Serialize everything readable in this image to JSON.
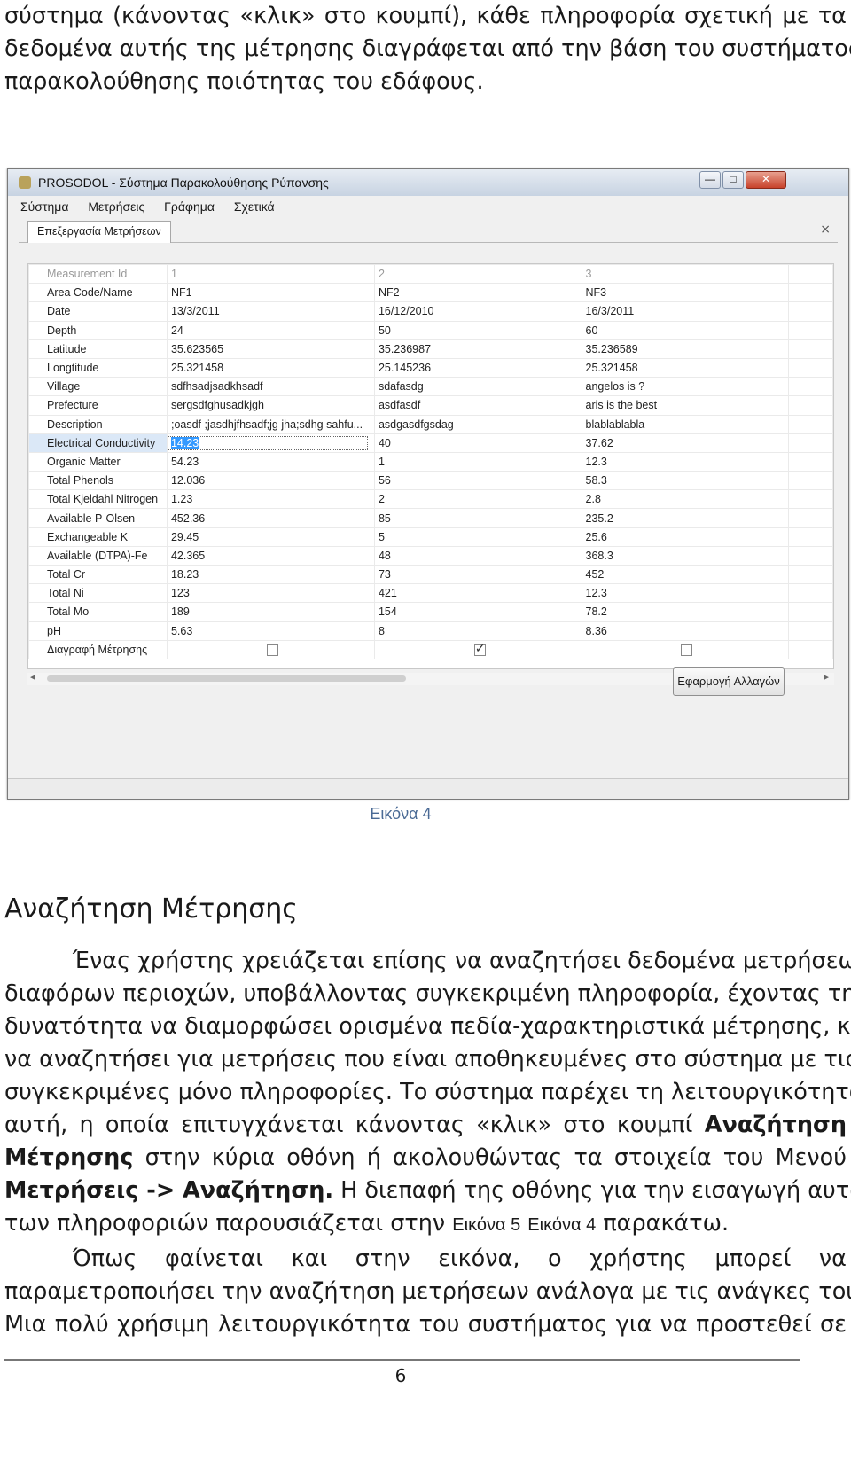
{
  "top_paragraph": [
    "σύστημα (κάνοντας «κλικ» στο κουμπί), κάθε πληροφορία σχετική με τα",
    "δεδομένα αυτής της μέτρησης διαγράφεται από την βάση του συστήματος",
    "παρακολούθησης ποιότητας του εδάφους."
  ],
  "window": {
    "title": "PROSODOL - Σύστημα Παρακολούθησης Ρύπανσης",
    "controls": {
      "minimize": "—",
      "maximize": "□",
      "close": "✕"
    },
    "menu": [
      "Σύστημα",
      "Μετρήσεις",
      "Γράφημα",
      "Σχετικά"
    ],
    "tab": "Επεξεργασία Μετρήσεων",
    "tab_close": "×",
    "grid": {
      "header": {
        "label": "Measurement Id",
        "values": [
          "1",
          "2",
          "3"
        ]
      },
      "rows": [
        {
          "label": "Area Code/Name",
          "values": [
            "NF1",
            "NF2",
            "NF3"
          ]
        },
        {
          "label": "Date",
          "values": [
            "13/3/2011",
            "16/12/2010",
            "16/3/2011"
          ]
        },
        {
          "label": "Depth",
          "values": [
            "24",
            "50",
            "60"
          ]
        },
        {
          "label": "Latitude",
          "values": [
            "35.623565",
            "35.236987",
            "35.236589"
          ]
        },
        {
          "label": "Longtitude",
          "values": [
            "25.321458",
            "25.145236",
            "25.321458"
          ]
        },
        {
          "label": "Village",
          "values": [
            "sdfhsadjsadkhsadf",
            "sdafasdg",
            "angelos is ?"
          ]
        },
        {
          "label": "Prefecture",
          "values": [
            "sergsdfghusadkjgh",
            "asdfasdf",
            "aris is the best"
          ]
        },
        {
          "label": "Description",
          "values": [
            ";oasdf ;jasdhjfhsadf;jg jha;sdhg sahfu...",
            "asdgasdfgsdag",
            "blablablabla"
          ]
        },
        {
          "label": "Electrical Conductivity",
          "values": [
            "14.23",
            "40",
            "37.62"
          ]
        },
        {
          "label": "Organic Matter",
          "values": [
            "54.23",
            "1",
            "12.3"
          ]
        },
        {
          "label": "Total Phenols",
          "values": [
            "12.036",
            "56",
            "58.3"
          ]
        },
        {
          "label": "Total Kjeldahl Nitrogen",
          "values": [
            "1.23",
            "2",
            "2.8"
          ]
        },
        {
          "label": "Available P-Olsen",
          "values": [
            "452.36",
            "85",
            "235.2"
          ]
        },
        {
          "label": "Exchangeable K",
          "values": [
            "29.45",
            "5",
            "25.6"
          ]
        },
        {
          "label": "Available (DTPA)-Fe",
          "values": [
            "42.365",
            "48",
            "368.3"
          ]
        },
        {
          "label": "Total Cr",
          "values": [
            "18.23",
            "73",
            "452"
          ]
        },
        {
          "label": "Total Ni",
          "values": [
            "123",
            "421",
            "12.3"
          ]
        },
        {
          "label": "Total Mo",
          "values": [
            "189",
            "154",
            "78.2"
          ]
        },
        {
          "label": "pH",
          "values": [
            "5.63",
            "8",
            "8.36"
          ]
        }
      ],
      "delete_row": {
        "label": "Διαγραφή Μέτρησης",
        "checked": [
          false,
          true,
          false
        ]
      }
    },
    "scroll_left": "◂",
    "scroll_right": "▸",
    "apply_button": "Εφαρμογή Αλλαγών"
  },
  "caption": "Εικόνα 4",
  "heading": "Αναζήτηση Μέτρησης",
  "para2": {
    "l1": "Ένας χρήστης χρειάζεται επίσης να αναζητήσει δεδομένα μετρήσεων",
    "l2": "διαφόρων περιοχών, υποβάλλοντας συγκεκριμένη πληροφορία, έχοντας την",
    "l3": "δυνατότητα να διαμορφώσει ορισμένα πεδία-χαρακτηριστικά μέτρησης, και",
    "l4": "να αναζητήσει για μετρήσεις που είναι αποθηκευμένες στο σύστημα με τις",
    "l5": "συγκεκριμένες μόνο πληροφορίες. Το σύστημα παρέχει τη λειτουργικότητα",
    "l6": "αυτή, η οποία επιτυγχάνεται κάνοντας «κλικ» στο κουμπί",
    "l6_bold": "Αναζήτηση",
    "l7_bold": "Μέτρησης",
    "l7": "στην κύρια οθόνη ή ακολουθώντας τα στοιχεία του Μενού",
    "l8_bold": "Μετρήσεις -> Αναζήτηση.",
    "l8": "Η διεπαφή της οθόνης για την εισαγωγή αυτών",
    "l9a": "των πληροφοριών παρουσιάζεται στην",
    "l9_ref1": "Εικόνα 5",
    "l9_ref2": "Εικόνα 4",
    "l9b": "παρακάτω."
  },
  "para3": [
    "Όπως φαίνεται και στην εικόνα, ο χρήστης μπορεί να",
    "παραμετροποιήσει την αναζήτηση μετρήσεων ανάλογα με τις ανάγκες του.",
    "Μια πολύ χρήσιμη λειτουργικότητα του συστήματος για να προστεθεί σε"
  ],
  "page_number": "6"
}
